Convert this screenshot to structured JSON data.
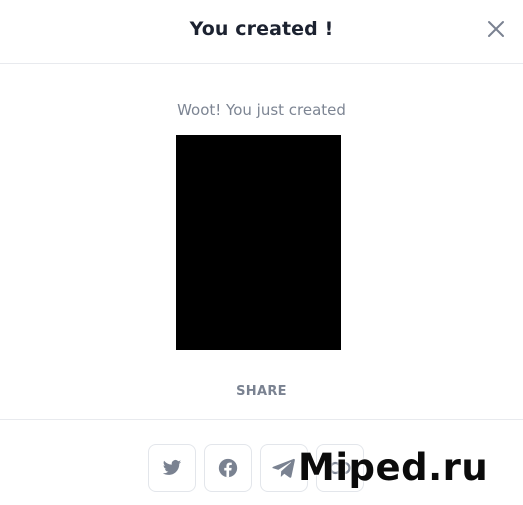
{
  "modal": {
    "title": "You created !",
    "subtitle": "Woot! You just created",
    "share_label": "SHARE"
  },
  "share_buttons": [
    {
      "name": "twitter",
      "icon": "twitter-icon"
    },
    {
      "name": "facebook",
      "icon": "facebook-icon"
    },
    {
      "name": "telegram",
      "icon": "telegram-icon"
    },
    {
      "name": "copy-link",
      "icon": "link-icon"
    }
  ],
  "watermark": "Miped.ru",
  "colors": {
    "title": "#1c2230",
    "muted_text": "#7d8593",
    "icon": "#7a8291",
    "border": "#e3e6eb",
    "preview": "#000000"
  }
}
